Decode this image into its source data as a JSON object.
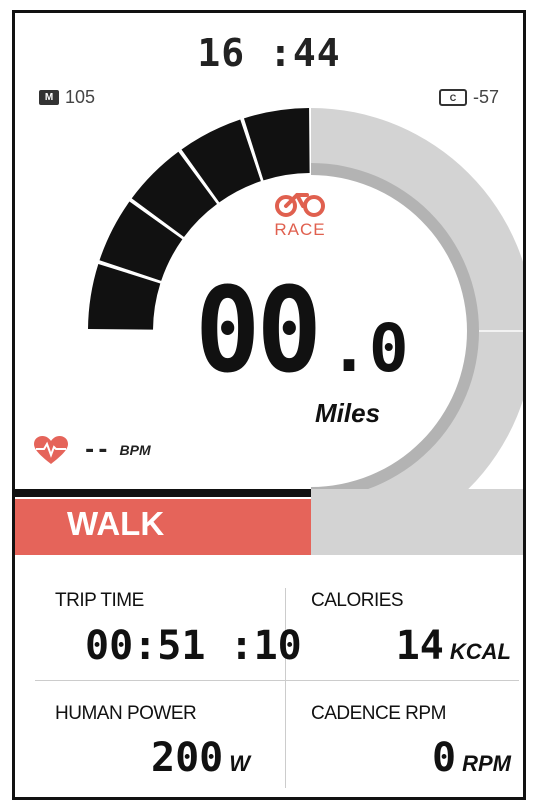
{
  "clock": "16 :44",
  "indicators": {
    "memory": {
      "badge": "M",
      "value": "105"
    },
    "calibration": {
      "badge": "C",
      "value": "-57"
    }
  },
  "gauge": {
    "segments_lit": 5,
    "colors": {
      "lit": "#111111",
      "track": "#d3d3d3",
      "inner_ring": "#b3b3b3",
      "accent": "#e5645a"
    }
  },
  "program": {
    "label": "RACE",
    "icon": "race-bike-icon"
  },
  "speed": {
    "main": "00",
    "decimal": ".0",
    "unit": "Miles"
  },
  "heart_rate": {
    "icon": "heart-rate-icon",
    "value": "--",
    "unit": "BPM"
  },
  "mode": {
    "label": "WALK"
  },
  "stats": {
    "trip_time": {
      "label": "TRIP TIME",
      "value": "00:51 :10",
      "unit": ""
    },
    "calories": {
      "label": "CALORIES",
      "value": "14",
      "unit": "KCAL"
    },
    "human_power": {
      "label": "HUMAN POWER",
      "value": "200",
      "unit": "W"
    },
    "cadence": {
      "label": "CADENCE RPM",
      "value": "0",
      "unit": "RPM"
    }
  }
}
